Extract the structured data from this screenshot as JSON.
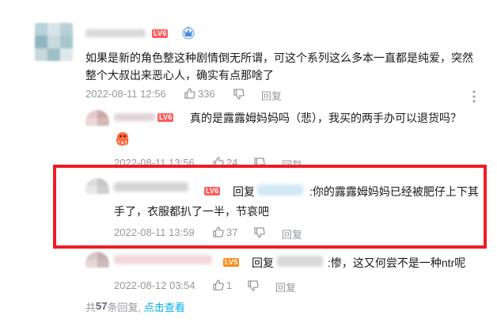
{
  "colors": {
    "lv6": "#ff6347",
    "lv5": "#ff8c00",
    "link": "#00aeec",
    "highlight_box": "#ee1c25"
  },
  "comment": {
    "level": "LV6",
    "text": "如果是新的角色整这种剧情倒无所谓，可这个系列这么多本一直都是纯爱，突然整个大叔出来恶心人，确实有点那啥了",
    "date": "2022-08-11 12:56",
    "likes": "336",
    "reply_label": "回复",
    "more_icon": "more-vertical-icon"
  },
  "replies": [
    {
      "level": "LV6",
      "text": "真的是露露姆妈妈吗（悲），我买的两手办可以退货吗？",
      "date": "2022-08-11 13:56",
      "likes": "24",
      "reply_label": "回复"
    },
    {
      "level": "LV6",
      "reply_kw": "回复",
      "text_line1": ":你的露露姆妈妈已经被肥仔上下其",
      "text_line2": "手了，衣服都扒了一半，节哀吧",
      "date": "2022-08-11 13:59",
      "likes": "37",
      "reply_label": "回复"
    },
    {
      "level": "LV5",
      "reply_kw": "回复",
      "text": ":惨，这又何尝不是一种ntr呢",
      "date": "2022-08-12 03:54",
      "likes": "1",
      "reply_label": "回复"
    }
  ],
  "footer": {
    "prefix": "共",
    "count": "57",
    "suffix": "条回复,",
    "link": "点击查看"
  }
}
